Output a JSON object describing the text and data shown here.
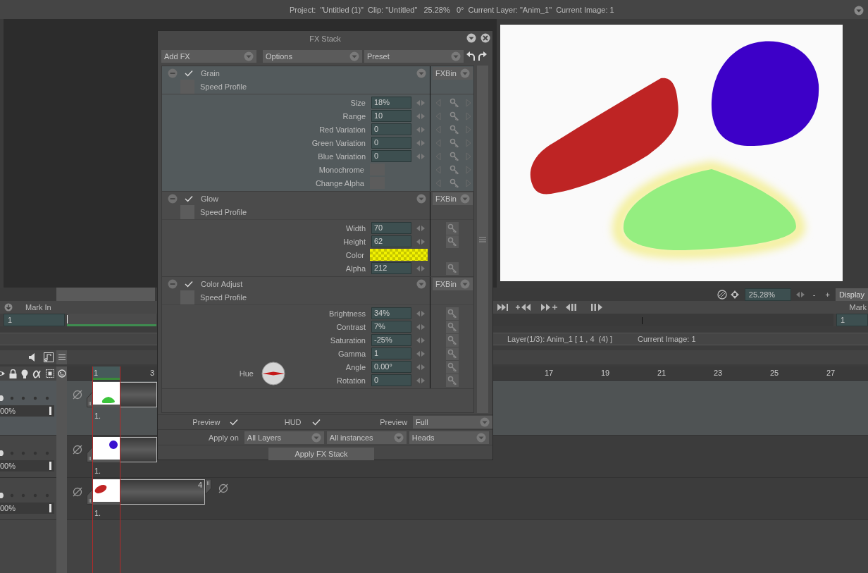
{
  "status_bar": {
    "text": "Project:  \"Untitled (1)\"  Clip: \"Untitled\"   25.28%   0°  Current Layer: \"Anim_1\"  Current Image: 1"
  },
  "viewer": {
    "zoom": "25.28%",
    "zoom_out": "-",
    "zoom_in": "+",
    "display": "Display"
  },
  "marks": {
    "mark_in": "Mark In",
    "mark_in_value": "1",
    "mark_out": "Mark",
    "mark_out_value": "1"
  },
  "layer_info": {
    "layer": "Layer(1/3): Anim_1 [ 1 , 4  (4) ]",
    "current_image": "Current Image: 1"
  },
  "timeline": {
    "ruler": [
      {
        "label": "1",
        "selected": true
      },
      {
        "label": "3",
        "selected": false
      }
    ],
    "ruler_far": [
      "17",
      "19",
      "21",
      "23",
      "25",
      "27"
    ],
    "layers": [
      {
        "kind": "blob",
        "color": "#3cc43c",
        "selected": true,
        "opacity": "00%",
        "frame": "1."
      },
      {
        "kind": "dot",
        "color": "#3a10d0",
        "selected": false,
        "opacity": "00%",
        "frame": "1."
      },
      {
        "kind": "oval",
        "color": "#c02424",
        "selected": false,
        "opacity": "00%",
        "frame": "1.",
        "end_frame": "4"
      }
    ]
  },
  "fx_stack": {
    "title": "FX Stack",
    "menus": [
      "Add FX",
      "Options",
      "Preset"
    ],
    "effects": [
      {
        "name": "Grain",
        "enabled": true,
        "selected": true,
        "bin": "FXBin",
        "speed_profile": "Speed Profile",
        "speed_checked": false,
        "params": [
          {
            "kind": "number",
            "label": "Size",
            "value": "18%"
          },
          {
            "kind": "number",
            "label": "Range",
            "value": "10"
          },
          {
            "kind": "number",
            "label": "Red Variation",
            "value": "0"
          },
          {
            "kind": "number",
            "label": "Green Variation",
            "value": "0"
          },
          {
            "kind": "number",
            "label": "Blue Variation",
            "value": "0"
          },
          {
            "kind": "checkbox",
            "label": "Monochrome",
            "checked": false
          },
          {
            "kind": "checkbox",
            "label": "Change Alpha",
            "checked": false
          }
        ]
      },
      {
        "name": "Glow",
        "enabled": true,
        "selected": false,
        "bin": "FXBin",
        "speed_profile": "Speed Profile",
        "speed_checked": false,
        "params": [
          {
            "kind": "number",
            "label": "Width",
            "value": "70"
          },
          {
            "kind": "number",
            "label": "Height",
            "value": "62"
          },
          {
            "kind": "color",
            "label": "Color",
            "color": "#f2f200"
          },
          {
            "kind": "number",
            "label": "Alpha",
            "value": "212"
          }
        ]
      },
      {
        "name": "Color Adjust",
        "enabled": true,
        "selected": false,
        "bin": "FXBin",
        "speed_profile": "Speed Profile",
        "speed_checked": false,
        "dial": {
          "label": "Hue"
        },
        "params": [
          {
            "kind": "number",
            "label": "Brightness",
            "value": "34%"
          },
          {
            "kind": "number",
            "label": "Contrast",
            "value": "7%"
          },
          {
            "kind": "number",
            "label": "Saturation",
            "value": "-25%"
          },
          {
            "kind": "number",
            "label": "Gamma",
            "value": "1"
          },
          {
            "kind": "number",
            "label": "Angle",
            "value": "0.00°"
          },
          {
            "kind": "number",
            "label": "Rotation",
            "value": "0"
          }
        ]
      }
    ],
    "footer": {
      "preview_label": "Preview",
      "preview": true,
      "hud_label": "HUD",
      "hud": true,
      "preview_mode_label": "Preview",
      "preview_mode": "Full",
      "apply_on_label": "Apply on",
      "apply_on": [
        "All Layers",
        "All instances",
        "Heads"
      ],
      "apply_button": "Apply FX Stack"
    }
  }
}
